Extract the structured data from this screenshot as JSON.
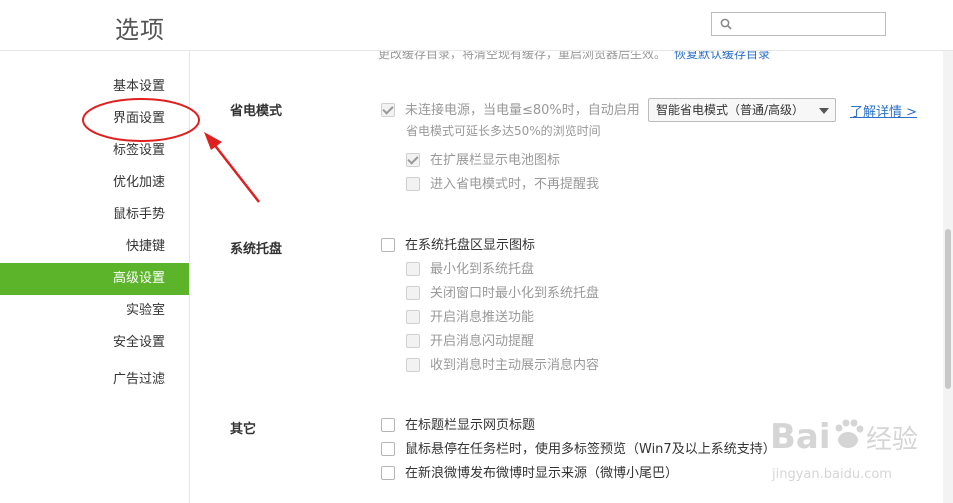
{
  "header": {
    "title": "选项",
    "search": {
      "value": "",
      "placeholder": ""
    }
  },
  "sidebar": {
    "items": [
      {
        "label": "基本设置",
        "active": false
      },
      {
        "label": "界面设置",
        "active": false
      },
      {
        "label": "标签设置",
        "active": false
      },
      {
        "label": "优化加速",
        "active": false
      },
      {
        "label": "鼠标手势",
        "active": false
      },
      {
        "label": "快捷键",
        "active": false
      },
      {
        "label": "高级设置",
        "active": true
      },
      {
        "label": "实验室",
        "active": false
      },
      {
        "label": "安全设置",
        "active": false
      },
      {
        "label": "广告过滤",
        "active": false
      }
    ]
  },
  "main": {
    "top_note": "更改缓存目录，将清空现有缓存，重启浏览器后生效。",
    "top_note_link": "恢复默认缓存目录",
    "power_saving": {
      "label": "省电模式",
      "auto_enable": {
        "label": "未连接电源，当电量≤80%时，自动启用",
        "checked": true,
        "disabled": true
      },
      "note": "省电模式可延长多达50%的浏览时间",
      "mode_select": "智能省电模式（普通/高级）",
      "learn_more": "了解详情 >",
      "battery_icon": {
        "label": "在扩展栏显示电池图标",
        "checked": true,
        "disabled": true
      },
      "no_remind": {
        "label": "进入省电模式时，不再提醒我",
        "checked": false,
        "disabled": true
      }
    },
    "system_tray": {
      "label": "系统托盘",
      "show_icon": {
        "label": "在系统托盘区显示图标",
        "checked": false
      },
      "minimize_to_tray": {
        "label": "最小化到系统托盘",
        "checked": false,
        "disabled": true
      },
      "close_to_tray": {
        "label": "关闭窗口时最小化到系统托盘",
        "checked": false,
        "disabled": true
      },
      "push": {
        "label": "开启消息推送功能",
        "checked": false,
        "disabled": true
      },
      "flash": {
        "label": "开启消息闪动提醒",
        "checked": false,
        "disabled": true
      },
      "auto_show": {
        "label": "收到消息时主动展示消息内容",
        "checked": false,
        "disabled": true
      }
    },
    "other": {
      "label": "其它",
      "show_title": {
        "label": "在标题栏显示网页标题",
        "checked": false
      },
      "taskbar_preview": {
        "label": "鼠标悬停在任务栏时，使用多标签预览（Win7及以上系统支持）",
        "checked": false
      },
      "weibo_source": {
        "label": "在新浪微博发布微博时显示来源（微博小尾巴）",
        "checked": false
      }
    }
  },
  "watermark": {
    "brand": "Bai",
    "brand2": "经验",
    "url": "jingyan.baidu.com"
  },
  "colors": {
    "accent": "#5bb42a",
    "link": "#2a6fc9",
    "annotation": "#e02020"
  }
}
